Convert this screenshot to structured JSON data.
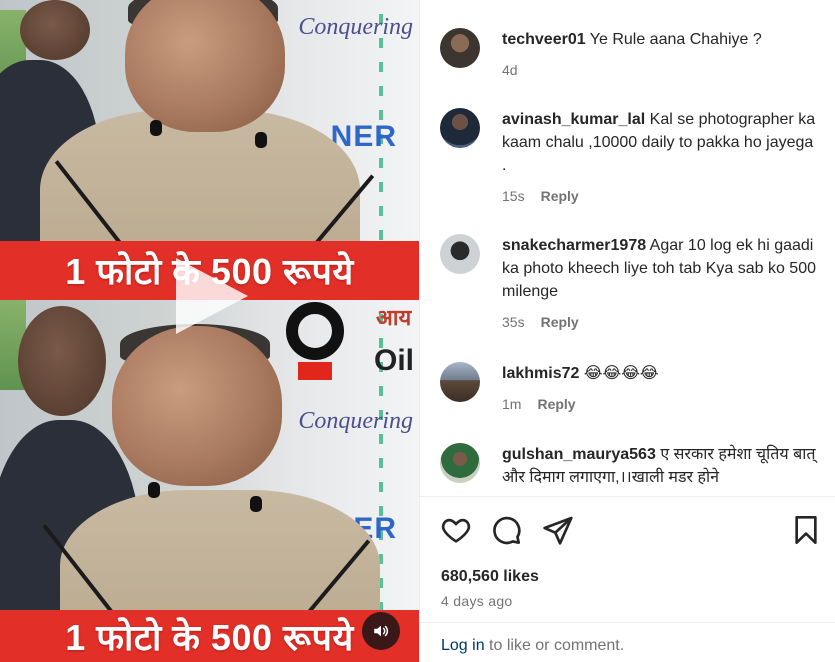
{
  "video": {
    "banner_text": "1 फोटो के 500 रूपये",
    "brand_word": "Conquering",
    "brand_partial": "NER",
    "logo_text": "Oil",
    "hindi_partial": "आय",
    "play_icon": "play-icon",
    "audio_icon": "speaker-icon"
  },
  "comments": [
    {
      "username": "techveer01",
      "text": "Ye Rule aana Chahiye ?",
      "time": "4d",
      "reply": ""
    },
    {
      "username": "avinash_kumar_lal",
      "text": "Kal se photographer ka kaam chalu ,10000 daily to pakka ho jayega .",
      "time": "15s",
      "reply": "Reply"
    },
    {
      "username": "snakecharmer1978",
      "text": "Agar 10 log ek hi gaadi ka photo kheech liye toh tab Kya sab ko 500 milenge",
      "time": "35s",
      "reply": "Reply"
    },
    {
      "username": "lakhmis72",
      "text": "😂😂😂😂",
      "time": "1m",
      "reply": "Reply"
    },
    {
      "username": "gulshan_maurya563",
      "text": "ए सरकार हमेशा चूतिय बात् और दिमाग लगाएगा,।।खाली मडर होने",
      "time": "",
      "reply": ""
    }
  ],
  "actions": {
    "like_icon": "heart-icon",
    "comment_icon": "comment-icon",
    "share_icon": "share-icon",
    "save_icon": "bookmark-icon"
  },
  "likes": "680,560 likes",
  "date": "4 days ago",
  "login": {
    "link": "Log in",
    "rest": " to like or comment."
  },
  "colors": {
    "banner": "#e22f27",
    "link": "#00376b",
    "muted": "#737373"
  }
}
